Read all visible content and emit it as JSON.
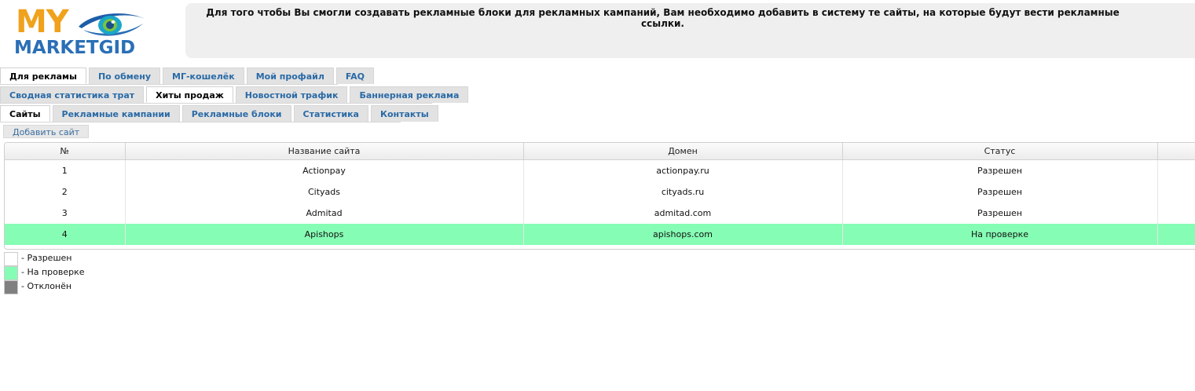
{
  "logo": {
    "line1": "MY",
    "line2": "MARKETGID"
  },
  "notice": "Для того чтобы Вы смогли создавать рекламные блоки для рекламных кампаний, Вам необходимо добавить в систему те сайты, на которые будут вести рекламные ссылки.",
  "tabs_main": [
    {
      "label": "Для рекламы"
    },
    {
      "label": "По обмену"
    },
    {
      "label": "МГ-кошелёк"
    },
    {
      "label": "Мой профайл"
    },
    {
      "label": "FAQ"
    }
  ],
  "tabs_section": [
    {
      "label": "Сводная статистика трат"
    },
    {
      "label": "Хиты продаж"
    },
    {
      "label": "Новостной трафик"
    },
    {
      "label": "Баннерная реклама"
    }
  ],
  "tabs_sub": [
    {
      "label": "Сайты"
    },
    {
      "label": "Рекламные кампании"
    },
    {
      "label": "Рекламные блоки"
    },
    {
      "label": "Статистика"
    },
    {
      "label": "Контакты"
    }
  ],
  "add_site_label": "Добавить сайт",
  "table": {
    "headers": [
      "№",
      "Название сайта",
      "Домен",
      "Статус",
      ""
    ],
    "rows": [
      {
        "num": "1",
        "name": "Actionpay",
        "domain": "actionpay.ru",
        "status": "Разрешен"
      },
      {
        "num": "2",
        "name": "Cityads",
        "domain": "cityads.ru",
        "status": "Разрешен"
      },
      {
        "num": "3",
        "name": "Admitad",
        "domain": "admitad.com",
        "status": "Разрешен"
      },
      {
        "num": "4",
        "name": "Apishops",
        "domain": "apishops.com",
        "status": "На проверке"
      }
    ]
  },
  "legend": [
    {
      "label": "- Разрешен",
      "color": "#ffffff"
    },
    {
      "label": "- На проверке",
      "color": "#86fdb4"
    },
    {
      "label": "- Отклонён",
      "color": "#808080"
    }
  ]
}
